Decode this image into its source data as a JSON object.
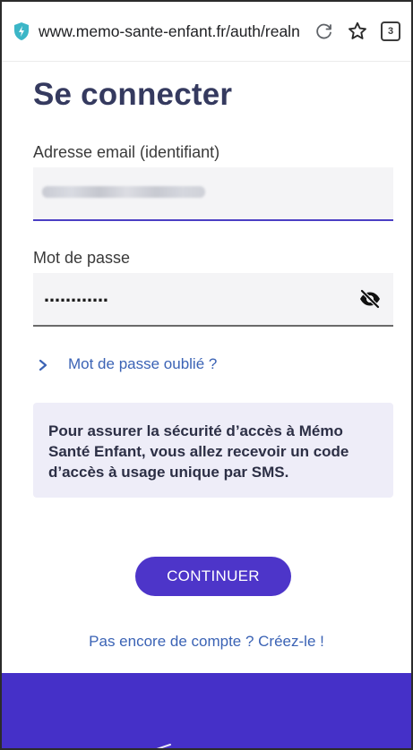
{
  "browser": {
    "url": "www.memo-sante-enfant.fr/auth/realn",
    "tab_count": "3",
    "site_icon": "shield-icon",
    "reload_icon": "reload-icon",
    "bookmark_icon": "star-outline-icon"
  },
  "page": {
    "title": "Se connecter"
  },
  "email": {
    "label": "Adresse email (identifiant)",
    "value_state": "blurred"
  },
  "password": {
    "label": "Mot de passe",
    "masked_value": "․․․․․․․․․․․․",
    "visibility_icon": "eye-slash-icon"
  },
  "forgot": {
    "label": "Mot de passe oublié ?"
  },
  "info": {
    "text": "Pour assurer la sécurité d’accès à Mémo Santé Enfant, vous allez recevoir un code d’accès à usage unique par SMS."
  },
  "actions": {
    "continue_label": "CONTINUER",
    "signup_label": "Pas encore de compte ? Créez-le !"
  },
  "colors": {
    "brand_purple": "#4530c8",
    "button_purple": "#4d35c9",
    "link_blue": "#3b63b5",
    "title_navy": "#353a5f",
    "info_background": "#eeedf8",
    "shield_teal": "#3cb6c7"
  }
}
